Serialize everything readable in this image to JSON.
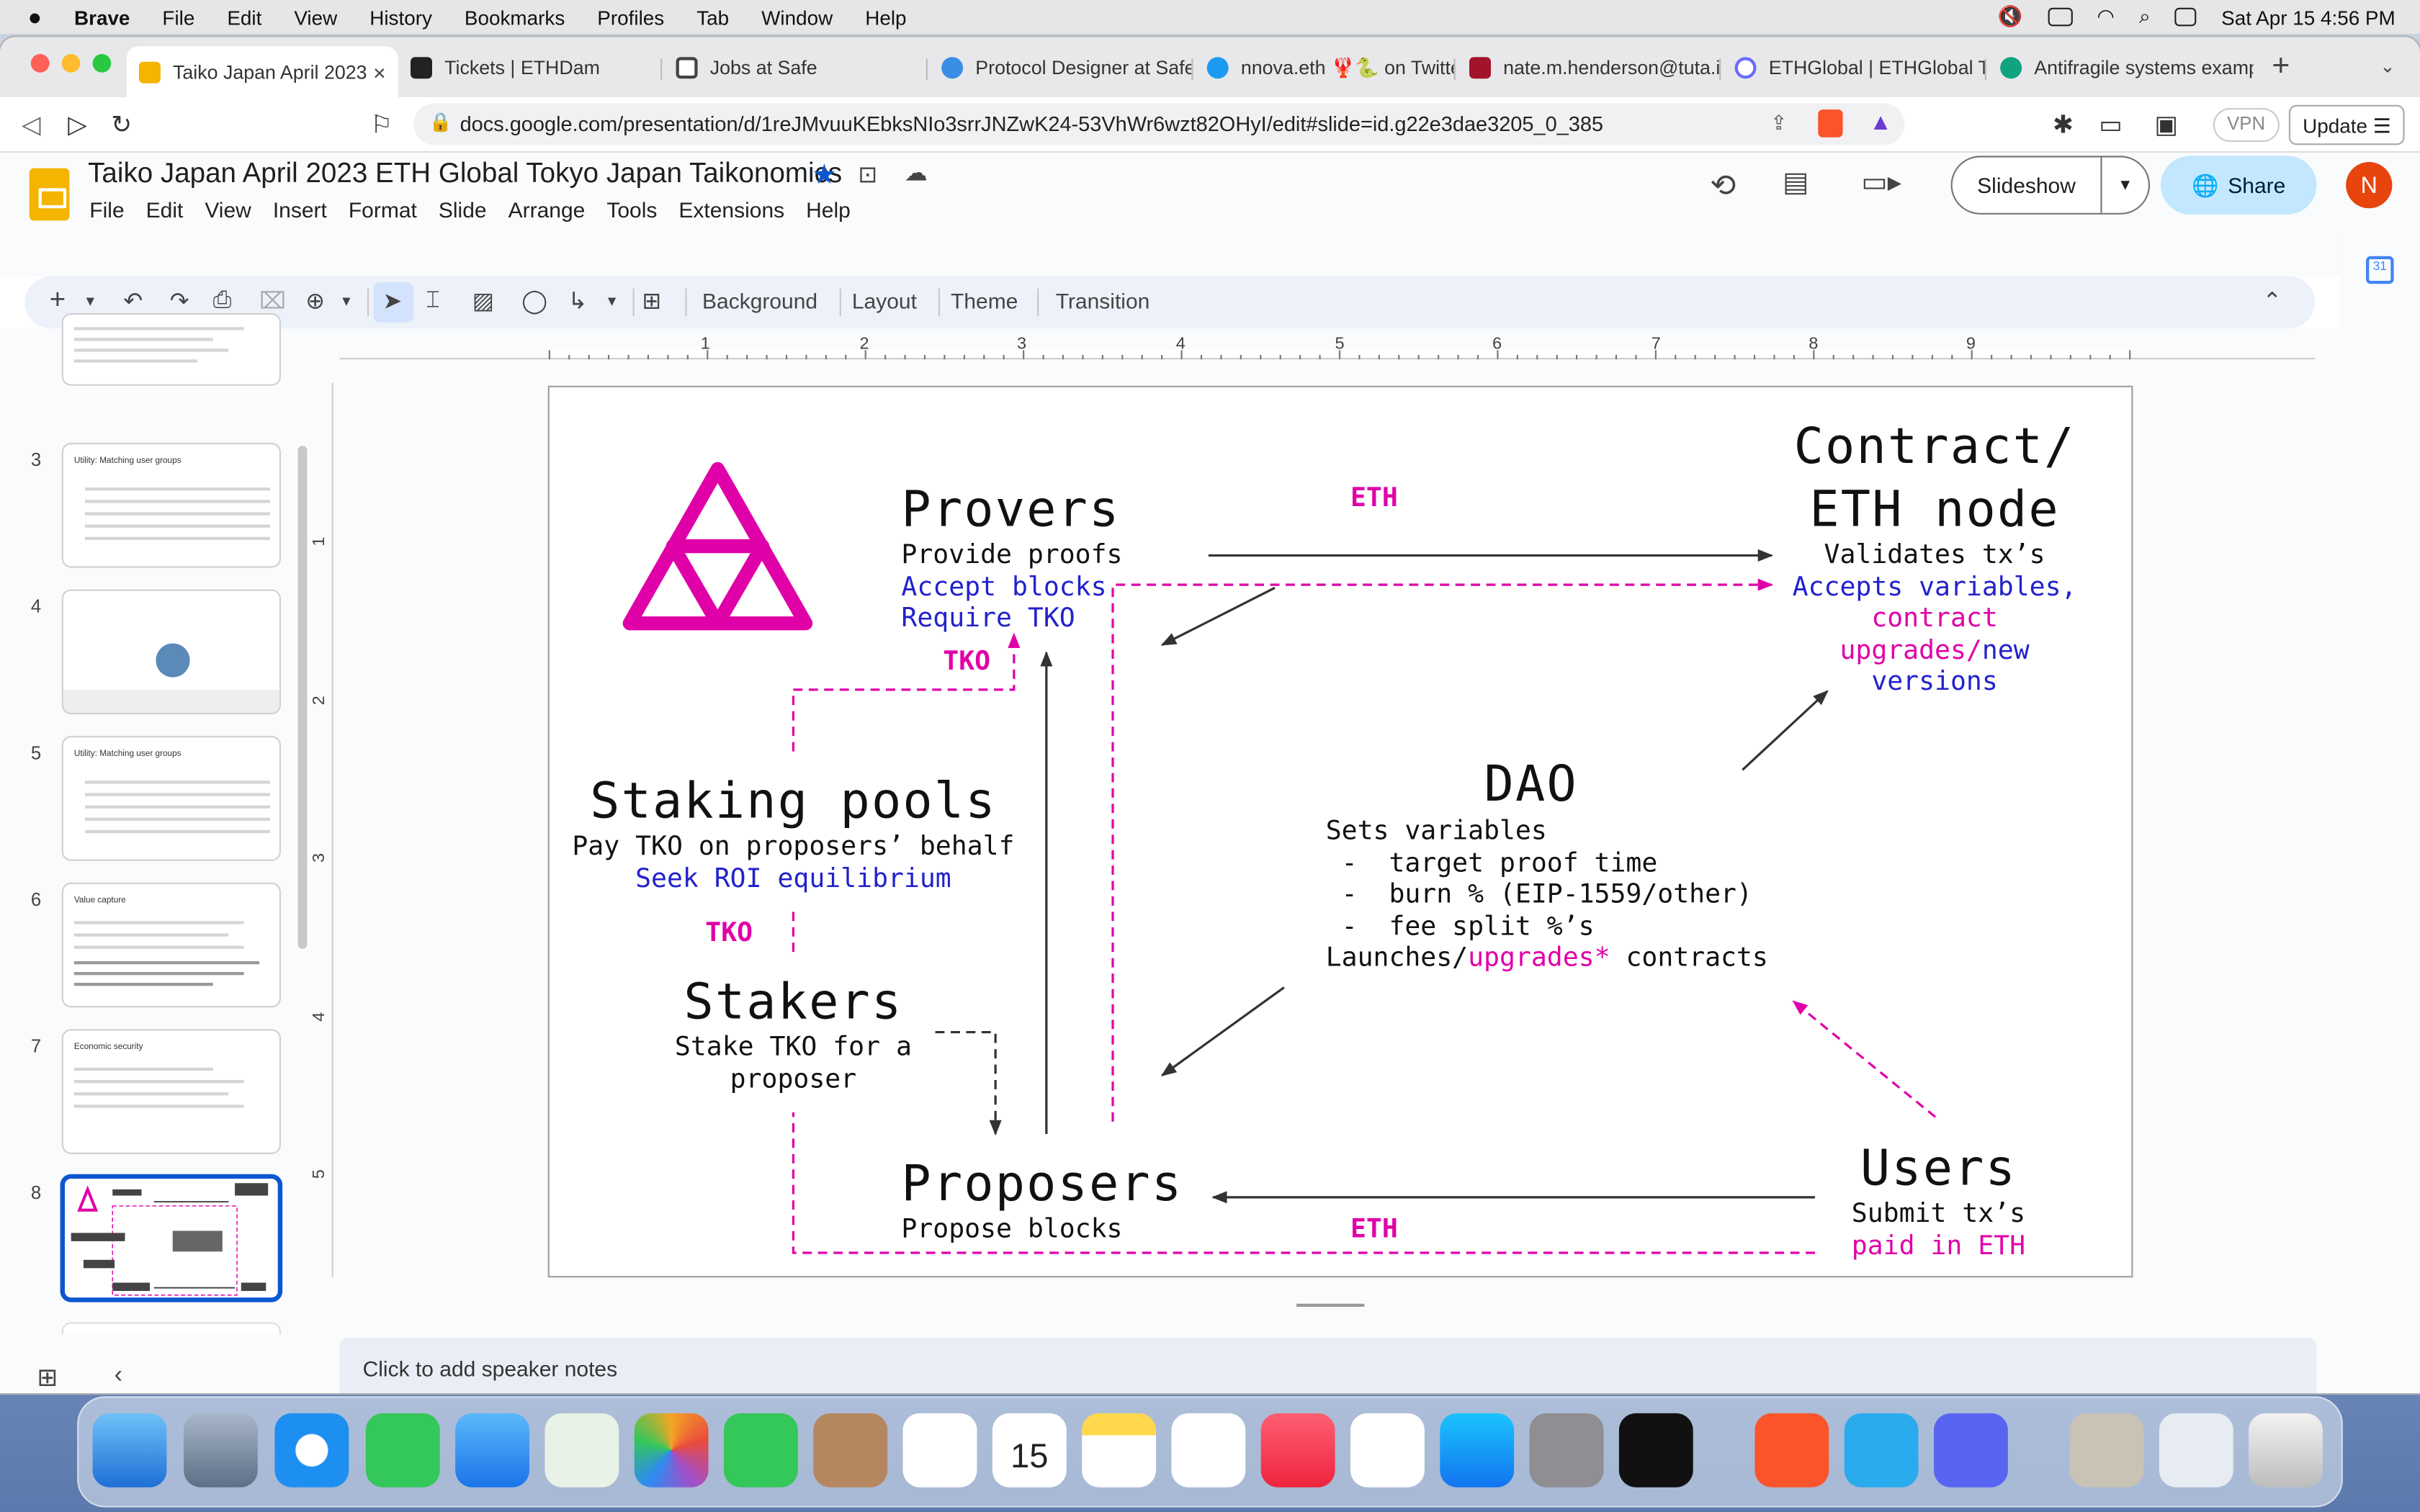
{
  "menubar": {
    "app": "Brave",
    "items": [
      "File",
      "Edit",
      "View",
      "History",
      "Bookmarks",
      "Profiles",
      "Tab",
      "Window",
      "Help"
    ],
    "clock": "Sat Apr 15  4:56 PM"
  },
  "tabs": [
    {
      "title": "Taiko Japan April 2023",
      "color": "#f4b400"
    },
    {
      "title": "Tickets | ETHDam",
      "color": "#222222"
    },
    {
      "title": "Jobs at Safe",
      "color": "#444444"
    },
    {
      "title": "Protocol Designer at Safe",
      "color": "#3a8ee6"
    },
    {
      "title": "nnova.eth 🦞🐍 on Twitter",
      "color": "#1d9bf0"
    },
    {
      "title": "nate.m.henderson@tuta.io",
      "color": "#a3142c"
    },
    {
      "title": "ETHGlobal | ETHGlobal To",
      "color": "#6b6bff"
    },
    {
      "title": "Antifragile systems examp",
      "color": "#10a37f"
    }
  ],
  "address": {
    "url": "docs.google.com/presentation/d/1reJMvuuKEbksNIo3srrJNZwK24-53VhWr6wzt82OHyI/edit#slide=id.g22e3dae3205_0_385",
    "vpn": "VPN",
    "update": "Update"
  },
  "doc": {
    "title": "Taiko Japan April 2023 ETH Global Tokyo Japan Taikonomics",
    "menu": [
      "File",
      "Edit",
      "View",
      "Insert",
      "Format",
      "Slide",
      "Arrange",
      "Tools",
      "Extensions",
      "Help"
    ],
    "slideshow": "Slideshow",
    "share": "Share",
    "avatar": "N"
  },
  "toolbar": {
    "background": "Background",
    "layout": "Layout",
    "theme": "Theme",
    "transition": "Transition"
  },
  "ruler": [
    "1",
    "2",
    "3",
    "4",
    "5",
    "6",
    "7",
    "8",
    "9"
  ],
  "vruler": [
    "1",
    "2",
    "3",
    "4",
    "5"
  ],
  "filmstrip": [
    {
      "num": "3",
      "title": "Utility: Matching user groups"
    },
    {
      "num": "4",
      "title": ""
    },
    {
      "num": "5",
      "title": "Utility: Matching user groups"
    },
    {
      "num": "6",
      "title": "Value capture"
    },
    {
      "num": "7",
      "title": "Economic security"
    },
    {
      "num": "8",
      "title": ""
    }
  ],
  "slide": {
    "provers": {
      "title": "Provers",
      "l1": "Provide proofs",
      "l2": "Accept blocks",
      "l3": "Require TKO"
    },
    "contract": {
      "t1": "Contract/",
      "t2": "ETH node",
      "l1": "Validates tx’s",
      "l2": "Accepts variables,",
      "l3": "contract",
      "l4a": "upgrades/",
      "l4b": "new",
      "l5": "versions"
    },
    "staking": {
      "title": "Staking pools",
      "l1": "Pay TKO on proposers’ behalf",
      "l2": "Seek ROI equilibrium"
    },
    "dao": {
      "title": "DAO",
      "l1": "Sets variables",
      "l2": " -  target proof time",
      "l3": " -  burn % (EIP-1559/other)",
      "l4": " -  fee split %’s",
      "l5a": "Launches/",
      "l5b": "upgrades*",
      "l5c": " contracts"
    },
    "stakers": {
      "title": "Stakers",
      "l1": "Stake TKO for a",
      "l2": "proposer"
    },
    "proposers": {
      "title": "Proposers",
      "l1": "Propose blocks"
    },
    "users": {
      "title": "Users",
      "l1": "Submit tx’s",
      "l2": "paid in ETH"
    },
    "labels": {
      "eth_top": "ETH",
      "tko_top": "TKO",
      "tko_mid": "TKO",
      "eth_bottom": "ETH"
    }
  },
  "notes": "Click to add speaker notes",
  "colors": {
    "brand_pink": "#e000a8",
    "blue_text": "#2222cc",
    "share_bg": "#c2e7ff"
  }
}
